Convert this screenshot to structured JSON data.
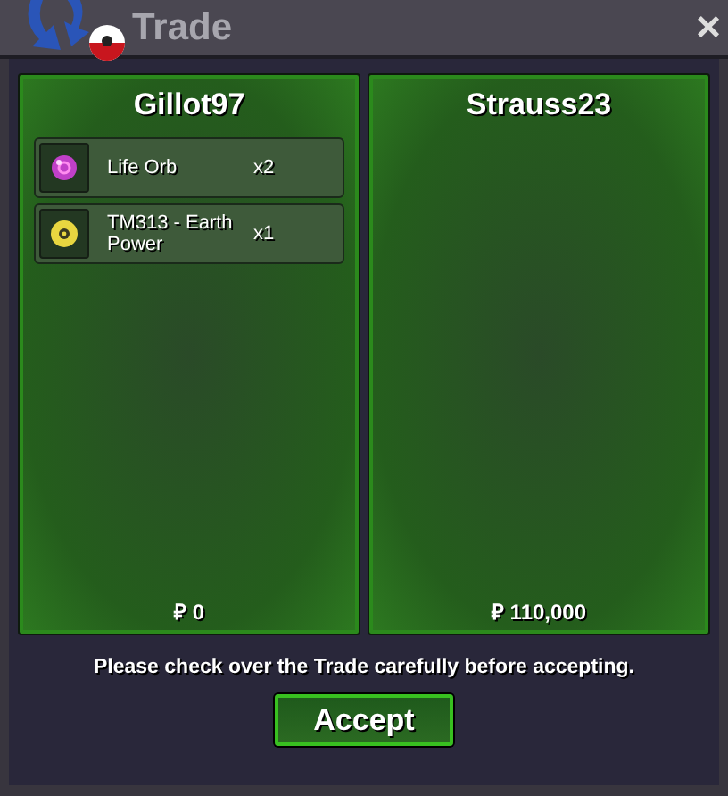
{
  "window": {
    "title": "Trade",
    "close": "×"
  },
  "offers": [
    {
      "player": "Gillot97",
      "items": [
        {
          "kind": "orb",
          "name": "Life Orb",
          "quantity": "x2"
        },
        {
          "kind": "disc",
          "name": "TM313 - Earth Power",
          "quantity": "x1"
        }
      ],
      "money": "₽ 0"
    },
    {
      "player": "Strauss23",
      "money": "₽ 110,000"
    }
  ],
  "notice": "Please check over the Trade carefully before accepting.",
  "buttons": [
    "Accept"
  ]
}
